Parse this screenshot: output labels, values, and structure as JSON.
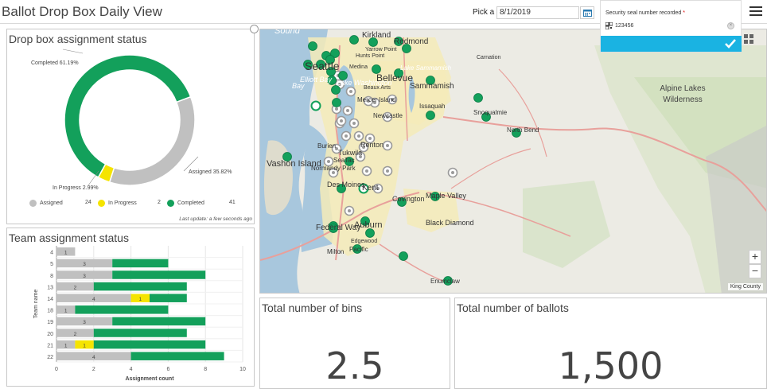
{
  "header": {
    "title": "Ballot Drop Box Daily View",
    "date_label": "Pick a date:",
    "date_value": "8/1/2019"
  },
  "donut": {
    "title": "Drop box assignment status",
    "label_completed": "Completed 61.19%",
    "label_assigned": "Assigned 35.82%",
    "label_inprogress": "In Progress 2.99%",
    "legend": [
      {
        "name": "Assigned",
        "count": "24",
        "color": "#c0c0c0"
      },
      {
        "name": "In Progress",
        "count": "2",
        "color": "#f5e400"
      },
      {
        "name": "Completed",
        "count": "41",
        "color": "#13a05b"
      }
    ],
    "last_update": "Last update: a few seconds ago"
  },
  "team": {
    "title": "Team assignment status",
    "ylabel": "Team name",
    "xlabel": "Assignment count"
  },
  "chart_data": [
    {
      "type": "pie",
      "title": "Drop box assignment status",
      "labels": [
        "Completed",
        "Assigned",
        "In Progress"
      ],
      "values": [
        41,
        24,
        2
      ],
      "percent": [
        61.19,
        35.82,
        2.99
      ],
      "colors": [
        "#13a05b",
        "#c0c0c0",
        "#f5e400"
      ]
    },
    {
      "type": "bar",
      "title": "Team assignment status",
      "orientation": "horizontal",
      "stacked": true,
      "xlabel": "Assignment count",
      "ylabel": "Team name",
      "categories": [
        "4",
        "5",
        "8",
        "13",
        "14",
        "18",
        "19",
        "20",
        "21",
        "22"
      ],
      "series": [
        {
          "name": "Assigned",
          "color": "#c0c0c0",
          "values": [
            1,
            3,
            3,
            2,
            4,
            1,
            3,
            2,
            1,
            4
          ]
        },
        {
          "name": "In Progress",
          "color": "#f5e400",
          "values": [
            0,
            0,
            0,
            0,
            1,
            0,
            0,
            0,
            1,
            0
          ]
        },
        {
          "name": "Completed",
          "color": "#13a05b",
          "values": [
            0,
            3,
            5,
            5,
            2,
            5,
            5,
            5,
            6,
            5
          ]
        }
      ],
      "xlim": [
        0,
        10
      ],
      "xticks": [
        "0",
        "2",
        "4",
        "6",
        "8",
        "10"
      ]
    }
  ],
  "map": {
    "place_labels": [
      "Kirkland",
      "Redmond",
      "Seattle",
      "Bellevue",
      "Sammamish",
      "Issaquah",
      "Snoqualmie",
      "North Bend",
      "Mercer Island",
      "Newcastle",
      "Renton",
      "Tukwila",
      "SeaTac",
      "Normandy Park",
      "Des Moines",
      "Kent",
      "Covington",
      "Maple Valley",
      "Black Diamond",
      "Federal Way",
      "Auburn",
      "Milton",
      "Pacific",
      "Enumclaw",
      "Vashon Island",
      "Alpine Lakes Wilderness",
      "Carnation",
      "Lake Sammamish",
      "Elliott Bay",
      "Lake Washington",
      "Sound",
      "Medina",
      "Yarrow Point",
      "Hunts Point",
      "Beaux Arts",
      "Burien",
      "Bay",
      "Edgewood"
    ],
    "zoom_in": "+",
    "zoom_out": "−",
    "attribution": "King County"
  },
  "kpis": {
    "bins_title": "Total number of bins",
    "bins_value": "2.5",
    "ballots_title": "Total number of ballots",
    "ballots_value": "1,500"
  },
  "popup": {
    "label": "Security seal number recorded",
    "required_mark": "*",
    "value": "123456"
  },
  "colors": {
    "completed": "#13a05b",
    "assigned": "#c0c0c0",
    "in_progress": "#f5e400",
    "accent": "#1ab3e2"
  }
}
